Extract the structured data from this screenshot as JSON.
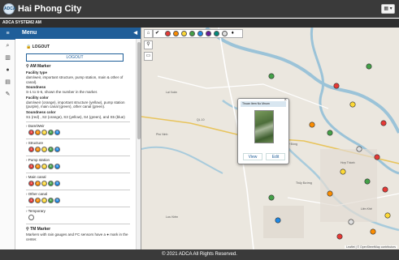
{
  "header": {
    "logo_text": "ADCA",
    "title": "Hai Phong City",
    "menu_glyph": "▦ ▾"
  },
  "subheader": {
    "text": "ADCA SYSTEM2 AM"
  },
  "icon_strip": [
    "menu-icon",
    "search-icon",
    "book-icon",
    "drop-icon",
    "database-icon",
    "pencil-icon"
  ],
  "panel": {
    "title": "Menu",
    "logout_section": "LOGOUT",
    "logout_button": "LOGOUT",
    "am_marker": {
      "title": "AM Marker",
      "facility_type_label": "Facility type",
      "facility_type_desc": "dam/weir, important structure, pump station, main & other of canal).",
      "soundness_label": "Soundness",
      "soundness_desc": "S-1 to S-5, shown the number in the marker.",
      "facility_color_label": "Facility color",
      "facility_color_desc": "dam/weir (orange), important structure (yellow), pump station (purple), main canal (green), other canal (green).",
      "soundness_color_label": "Soundness color",
      "soundness_color_desc": "S1 (red) , S2 (orange), S3 (yellow), S4 (green), and S5 (blue)"
    },
    "categories": [
      {
        "name": "Dam/Weir"
      },
      {
        "name": "Structure"
      },
      {
        "name": "Pump station"
      },
      {
        "name": "Main canal"
      },
      {
        "name": "Other canal"
      },
      {
        "name": "Temporary"
      }
    ],
    "tm_marker": {
      "title": "TM Marker",
      "desc": "Markers with rain gauges and FC sensors have a ● mark in the center."
    }
  },
  "soundness_colors": [
    "#e53935",
    "#fb8c00",
    "#fdd835",
    "#43a047",
    "#1e88e5"
  ],
  "map": {
    "legend_numbers": [
      "1",
      "2",
      "3",
      "4",
      "5"
    ],
    "places": [
      "Lại Xuân",
      "QL.10",
      "Phù Ninh",
      "Mỹ Đồng",
      "Hợp Thành",
      "Thủy Đường",
      "Lưu Kiếm",
      "Liên Khê"
    ],
    "popup": {
      "title": "Thuan Item No Mnum",
      "view_button": "View",
      "edit_button": "Edit"
    },
    "attribution": "Leaflet | © OpenStreetMap contributors"
  },
  "footer": {
    "text": "© 2021 ADCA All Rights Reserved."
  }
}
